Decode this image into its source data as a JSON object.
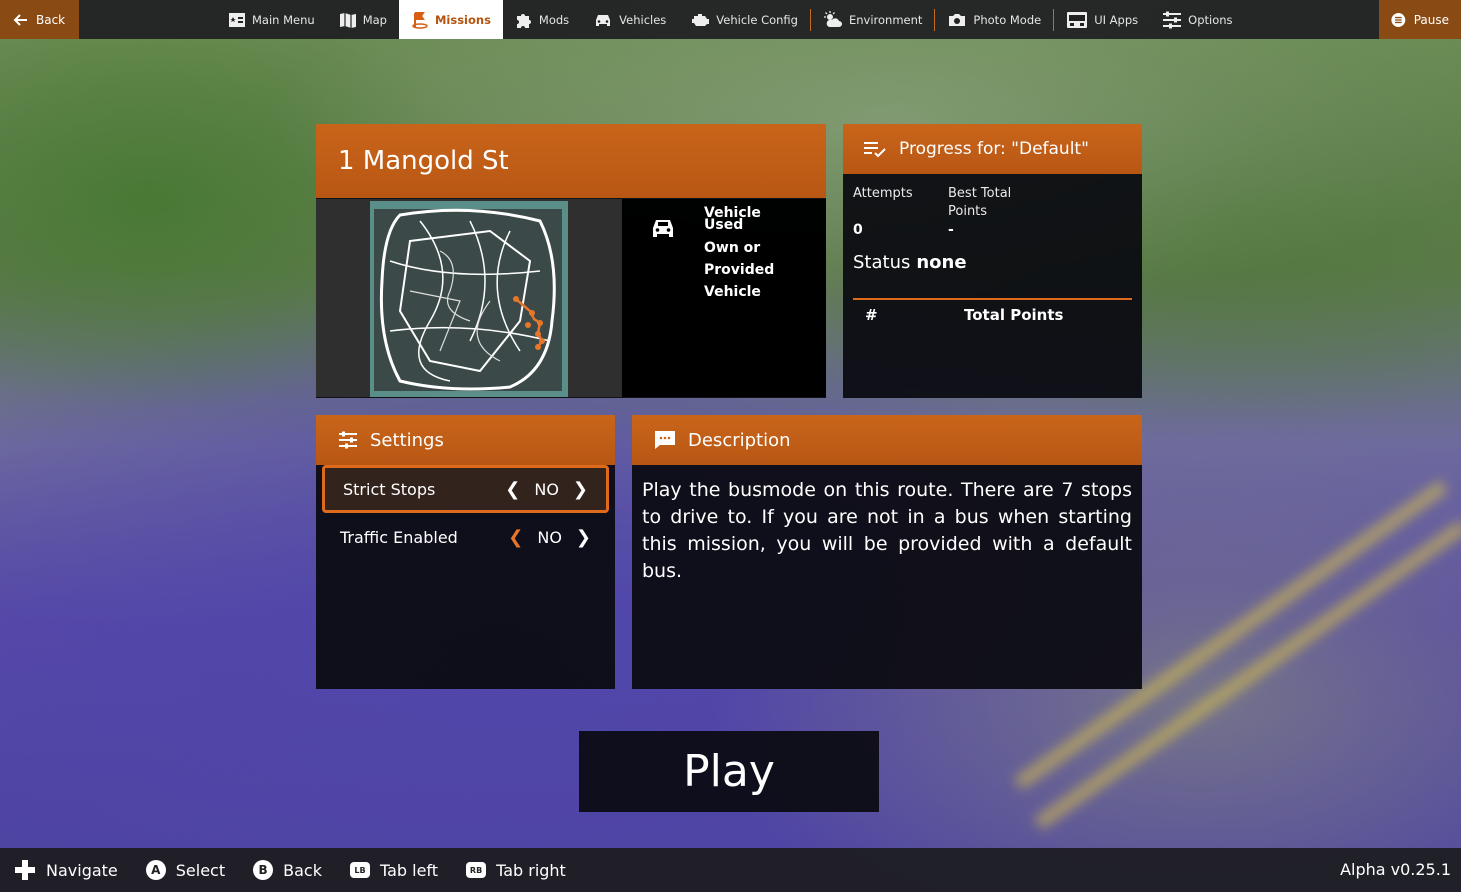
{
  "topbar": {
    "back_label": "Back",
    "pause_label": "Pause",
    "tabs": [
      {
        "label": "Main Menu",
        "icon": "main-menu-icon"
      },
      {
        "label": "Map",
        "icon": "map-icon"
      },
      {
        "label": "Missions",
        "icon": "missions-icon",
        "active": true
      },
      {
        "label": "Mods",
        "icon": "puzzle-icon"
      },
      {
        "label": "Vehicles",
        "icon": "car-icon"
      },
      {
        "label": "Vehicle Config",
        "icon": "engine-icon"
      },
      {
        "label": "Environment",
        "icon": "weather-icon"
      },
      {
        "label": "Photo Mode",
        "icon": "camera-icon"
      },
      {
        "label": "UI Apps",
        "icon": "ui-apps-icon"
      },
      {
        "label": "Options",
        "icon": "sliders-icon"
      }
    ]
  },
  "mission": {
    "title": "1 Mangold St",
    "vehicle_heading": "Vehicle Used",
    "vehicle_value": "Own or Provided Vehicle"
  },
  "progress": {
    "title": "Progress for: \"Default\"",
    "attempts_label": "Attempts",
    "attempts_value": "0",
    "best_label": "Best Total Points",
    "best_value": "-",
    "status_label": "Status",
    "status_value": "none",
    "col_num": "#",
    "col_points": "Total Points"
  },
  "settings": {
    "title": "Settings",
    "items": [
      {
        "label": "Strict Stops",
        "value": "NO",
        "selected": true
      },
      {
        "label": "Traffic Enabled",
        "value": "NO",
        "selected": false
      }
    ]
  },
  "description": {
    "title": "Description",
    "text": "Play the busmode on this route. There are 7 stops to drive to. If you are not in a bus when starting this mission, you will be provided with a default bus."
  },
  "play_label": "Play",
  "bottombar": {
    "items": [
      {
        "key": "",
        "label": "Navigate",
        "icon": "dpad-icon"
      },
      {
        "key": "A",
        "label": "Select"
      },
      {
        "key": "B",
        "label": "Back"
      },
      {
        "key": "LB",
        "label": "Tab left"
      },
      {
        "key": "RB",
        "label": "Tab right"
      }
    ],
    "version": "Alpha v0.25.1"
  },
  "colors": {
    "accent": "#c9651a",
    "highlight": "#e06a1c"
  }
}
